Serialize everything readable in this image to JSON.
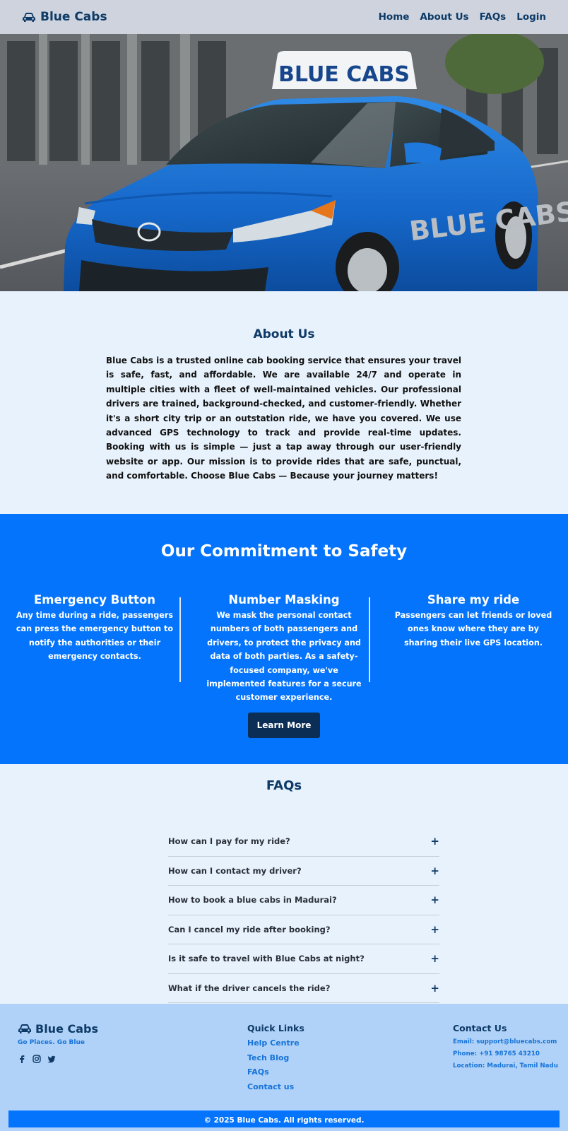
{
  "header": {
    "brand": "Blue Cabs",
    "brand_icon": "car-icon",
    "nav": [
      "Home",
      "About Us",
      "FAQs",
      "Login"
    ]
  },
  "hero": {
    "roof_sign": "BLUE CABS",
    "door_text": "BLUE CABS"
  },
  "about": {
    "title": "About Us",
    "text": "Blue Cabs is a trusted online cab booking service that ensures your travel is safe, fast, and affordable. We are available 24/7 and operate in multiple cities with a fleet of well-maintained vehicles. Our professional drivers are trained, background-checked, and customer-friendly. Whether it's a short city trip or an outstation ride, we have you covered. We use advanced GPS technology to track and provide real-time updates. Booking with us is simple — just a tap away through our user-friendly website or app. Our mission is to provide rides that are safe, punctual, and comfortable. Choose Blue Cabs — Because your journey matters!"
  },
  "safety": {
    "title": "Our Commitment to Safety",
    "features": [
      {
        "title": "Emergency Button",
        "text": "Any time during a ride, passengers can press the emergency button to notify the authorities or their emergency contacts."
      },
      {
        "title": "Number Masking",
        "text": "We mask the personal contact numbers of both passengers and drivers, to protect the privacy and data of both parties. As a safety-focused company, we've implemented features for a secure customer experience."
      },
      {
        "title": "Share my ride",
        "text": "Passengers can let friends or loved ones know where they are by sharing their live GPS location."
      }
    ],
    "button": "Learn More"
  },
  "faqs": {
    "title": "FAQs",
    "items": [
      "How can I pay for my ride?",
      "How can I contact my driver?",
      "How to book a blue cabs in Madurai?",
      "Can I cancel my ride after booking?",
      "Is it safe to travel with Blue Cabs at night?",
      "What if the driver cancels the ride?"
    ],
    "expand_symbol": "+"
  },
  "footer": {
    "brand": "Blue Cabs",
    "tagline": "Go Places. Go Blue",
    "socials": [
      "facebook-icon",
      "instagram-icon",
      "twitter-icon"
    ],
    "quick_links_title": "Quick Links",
    "quick_links": [
      "Help Centre",
      "Tech Blog",
      "FAQs",
      "Contact us"
    ],
    "contact_title": "Contact Us",
    "contact": [
      "Email: support@bluecabs.com",
      "Phone: +91 98765 43210",
      "Location: Madurai, Tamil Nadu"
    ],
    "copyright": "© 2025 Blue Cabs. All rights reserved."
  },
  "colors": {
    "header_bg": "#ced3de",
    "brand_navy": "#0d3a66",
    "safety_blue": "#0474fc",
    "page_bg": "#e8f2fc",
    "footer_bg": "#b0d2f8",
    "link_blue": "#1673d9"
  }
}
